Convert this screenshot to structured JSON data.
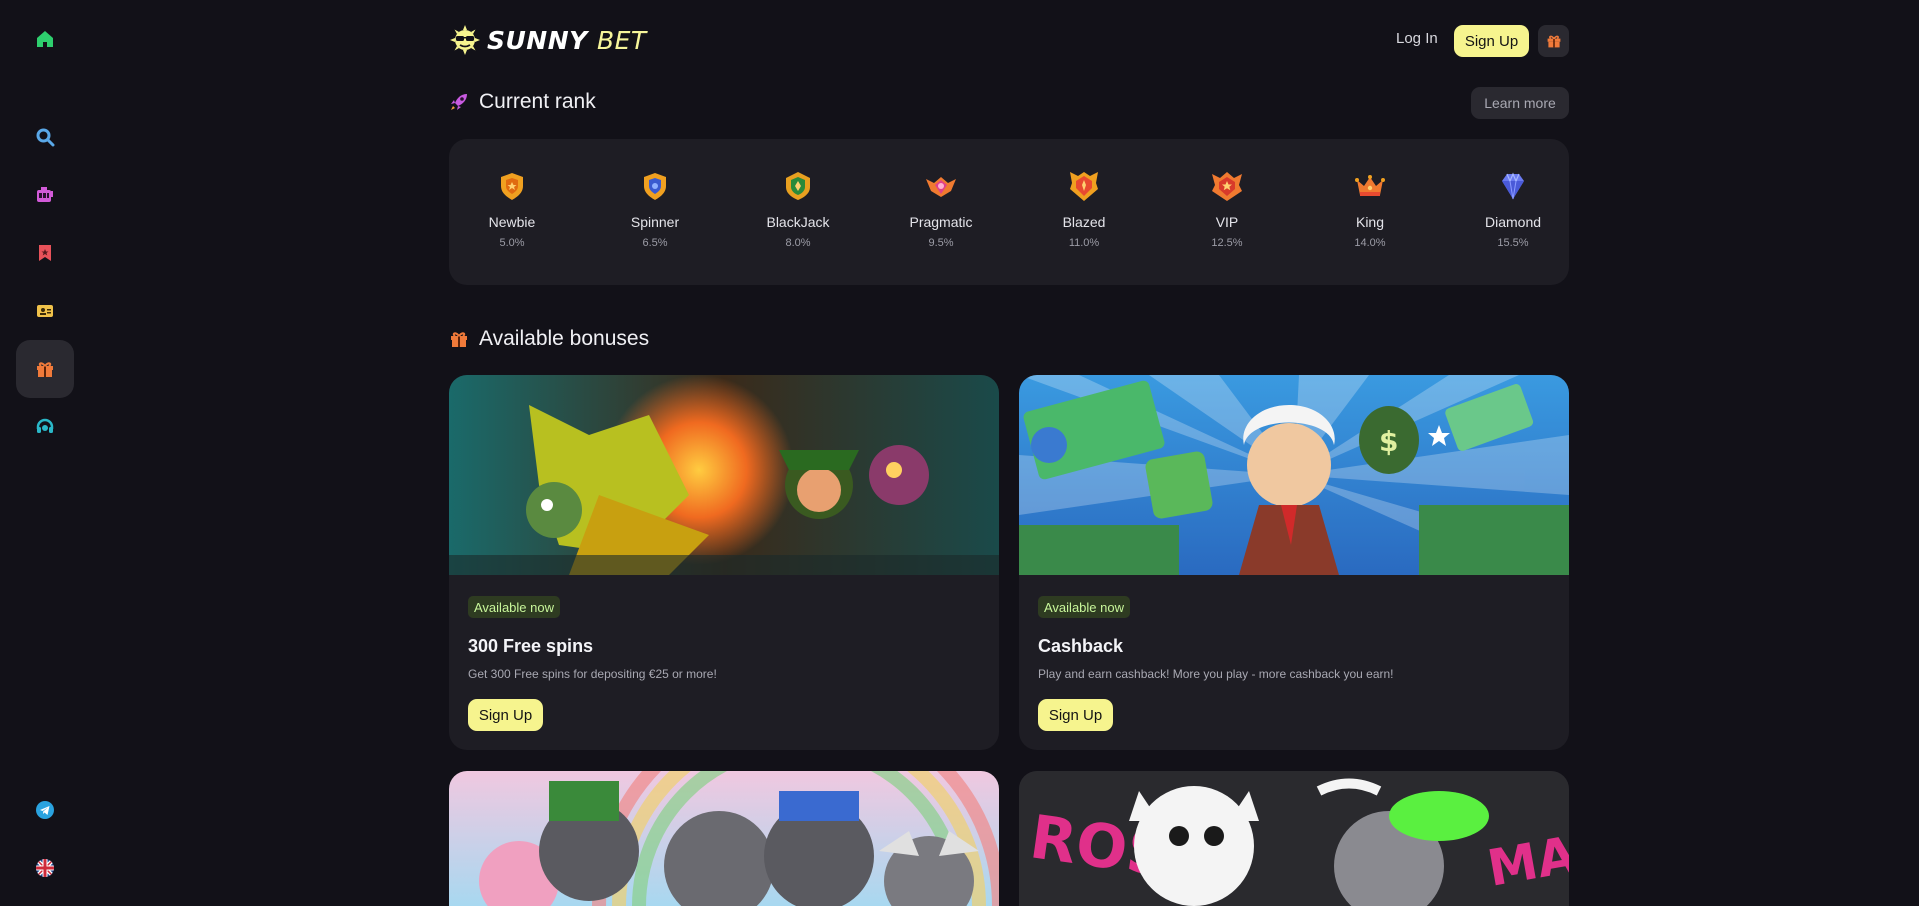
{
  "brand": {
    "name_part1": "SUNNY",
    "name_part2": "BET"
  },
  "header": {
    "login_label": "Log In",
    "signup_label": "Sign Up"
  },
  "sidebar": {
    "items": [
      {
        "icon": "home-icon",
        "color": "#2ecf6e"
      },
      {
        "icon": "search-icon",
        "color": "#5aa8e8"
      },
      {
        "icon": "slots-icon",
        "color": "#d25ad8"
      },
      {
        "icon": "bookmark-icon",
        "color": "#e8525a"
      },
      {
        "icon": "ticket-icon",
        "color": "#f0c24a"
      },
      {
        "icon": "gift-icon",
        "color": "#f07a3a"
      },
      {
        "icon": "support-icon",
        "color": "#2ab8c8"
      },
      {
        "icon": "telegram-icon",
        "color": "#2aa3e0"
      },
      {
        "icon": "uk-flag-icon",
        "color": "#cf2a3a"
      }
    ]
  },
  "rank_section": {
    "title": "Current rank",
    "learn_more_label": "Learn more",
    "ranks": [
      {
        "name": "Newbie",
        "percent": "5.0%",
        "color": "#f0a020"
      },
      {
        "name": "Spinner",
        "percent": "6.5%",
        "color": "#f0a020"
      },
      {
        "name": "BlackJack",
        "percent": "8.0%",
        "color": "#e8a020"
      },
      {
        "name": "Pragmatic",
        "percent": "9.5%",
        "color": "#e0408a"
      },
      {
        "name": "Blazed",
        "percent": "11.0%",
        "color": "#e84a30"
      },
      {
        "name": "VIP",
        "percent": "12.5%",
        "color": "#f07a30"
      },
      {
        "name": "King",
        "percent": "14.0%",
        "color": "#f05a30"
      },
      {
        "name": "Diamond",
        "percent": "15.5%",
        "color": "#6a7af0"
      }
    ]
  },
  "bonus_section": {
    "title": "Available bonuses",
    "cards": [
      {
        "badge": "Available now",
        "title": "300 Free spins",
        "description": "Get 300 Free spins for depositing €25 or more!",
        "button": "Sign Up"
      },
      {
        "badge": "Available now",
        "title": "Cashback",
        "description": "Play and earn cashback! More you play - more cashback you earn!",
        "button": "Sign Up"
      }
    ]
  },
  "colors": {
    "accent": "#f6f48e",
    "panel": "#1e1d24",
    "background": "#121118",
    "badge_text": "#c7f59a"
  }
}
